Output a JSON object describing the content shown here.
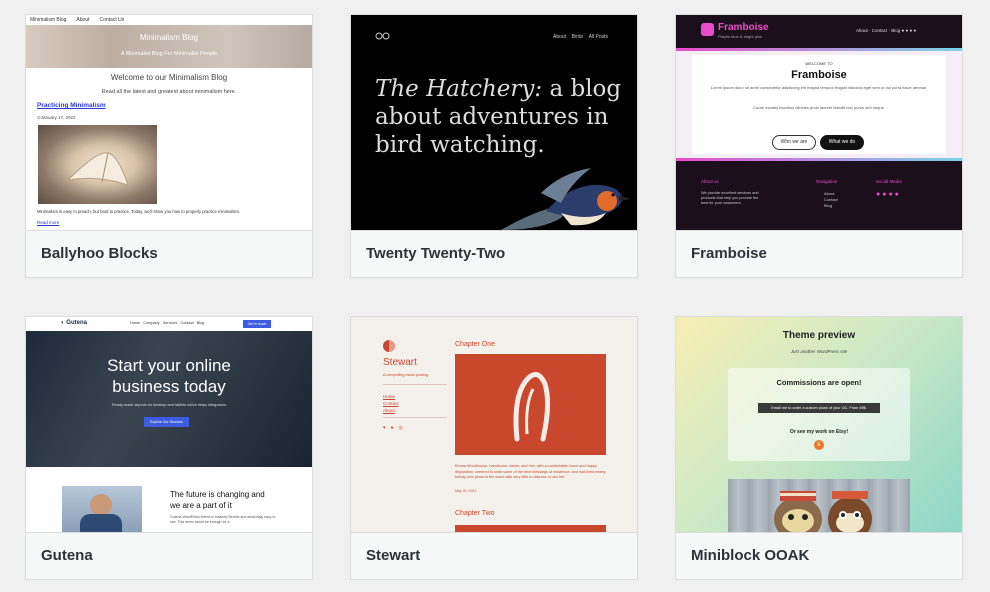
{
  "themes": [
    {
      "name": "Ballyhoo Blocks",
      "preview": {
        "nav": [
          "Minimalism Blog",
          "About",
          "Contact Us"
        ],
        "hero_title": "Minimalism Blog",
        "hero_subtitle": "A Minimalist Blog For Minimalist People",
        "welcome": "Welcome to our Minimalism Blog",
        "intro": "Read all the latest and greatest about minimalism here.",
        "post_title": "Practicing Minimalism",
        "post_date": "January 17, 2022",
        "excerpt": "Minimalism is easy to preach, but hard to practice. Today, we'll show you how to properly practice minimalism.",
        "read_more": "Read more"
      }
    },
    {
      "name": "Twenty Twenty-Two",
      "preview": {
        "nav": [
          "About",
          "Birds",
          "All Posts"
        ],
        "headline_italic": "The Hatchery:",
        "headline_line1": " a blog",
        "headline_line2": "about adventures in",
        "headline_line3": "bird watching."
      }
    },
    {
      "name": "Framboise",
      "preview": {
        "brand": "Framboise",
        "tagline": "Playful blue & bright pink",
        "nav": [
          "About",
          "Contact",
          "Blog"
        ],
        "welcome": "WELCOME TO",
        "title": "Framboise",
        "para1": "Lorem ipsum dolor sit amet consectetur adipiscing elit magna tempus feugiat ridiculus eget sem ut dui porta fusce aenean.",
        "para2": "Curae montes faucibus ultricies proin laoreet blandit non purus sed neque.",
        "btn1": "Who we are",
        "btn2": "What we do",
        "footer_about_title": "About us",
        "footer_about": "We provide excellent services and products that help you provide the best for your customers.",
        "footer_nav_title": "Navigation",
        "footer_nav": [
          "About",
          "Contact",
          "Blog"
        ],
        "footer_social_title": "Social Media"
      }
    },
    {
      "name": "Gutena",
      "preview": {
        "brand": "Gutena",
        "nav": [
          "Home",
          "Company",
          "Services",
          "Contact",
          "Blog"
        ],
        "cta": "Get in touch",
        "hero_title_1": "Start your online",
        "hero_title_2": "business today",
        "hero_sub": "Ready made layouts for desktop and tablets which helps integrators",
        "hero_btn": "Explore Our Services",
        "section_title_1": "The future is changing and",
        "section_title_2": "we are a part of it",
        "section_text": "Gutena WordPress theme is insanely flexible and amazingly easy to use. This demo would be enough for a"
      }
    },
    {
      "name": "Stewart",
      "preview": {
        "site": "Stewart",
        "tagline": "A compelling travel posting",
        "menu": [
          "Home",
          "Contact",
          "About"
        ],
        "chapter1": "Chapter One",
        "excerpt": "Emma Woodhouse, handsome, clever, and rich, with a comfortable home and happy disposition, seemed to unite some of the best blessings of existence; and had lived nearly twenty-one years in the world with very little to distress or vex her.",
        "date": "May 20, 2021",
        "chapter2": "Chapter Two"
      }
    },
    {
      "name": "Miniblock OOAK",
      "preview": {
        "title": "Theme preview",
        "subtitle": "Just another WordPress site",
        "box_title": "Commissions are open!",
        "box_btn": "Email me to order a custom plush of your OC. From 49$.",
        "box_text": "Or see my work on Etsy!"
      }
    }
  ]
}
